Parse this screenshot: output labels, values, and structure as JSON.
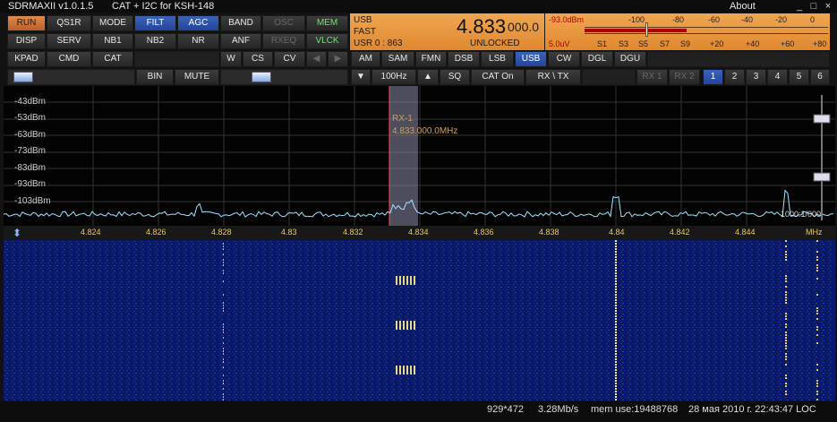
{
  "titlebar": {
    "app_name": "SDRMAXII v1.0.1.5",
    "subtitle": "CAT  + I2C for  KSH-148",
    "about": "About",
    "minimize": "_",
    "maximize": "□",
    "close": "×"
  },
  "controls": {
    "row1": [
      "RUN",
      "QS1R",
      "MODE",
      "FILT",
      "AGC",
      "BAND",
      "OSC",
      "MEM"
    ],
    "row2": [
      "DISP",
      "SERV",
      "NB1",
      "NB2",
      "NR",
      "ANF",
      "RXEQ",
      "VLCK"
    ],
    "row3": [
      "KPAD",
      "CMD",
      "CAT",
      "W",
      "CS",
      "CV"
    ],
    "modes": [
      "AM",
      "SAM",
      "FMN",
      "DSB",
      "LSB",
      "USB",
      "CW",
      "DGL",
      "DGU"
    ],
    "active_mode": "USB",
    "row4": {
      "bin": "BIN",
      "mute": "MUTE",
      "step": "100Hz",
      "sq": "SQ",
      "cat_on": "CAT On",
      "rx_tx": "RX \\ TX",
      "rx1": "RX 1",
      "rx2": "RX 2",
      "channels": [
        "1",
        "2",
        "3",
        "4",
        "5",
        "6"
      ]
    }
  },
  "status": {
    "mode": "USB",
    "agc": "FAST",
    "usr": "USR 0 : 863",
    "frequency_main": "4.833",
    "frequency_sub": "000.0",
    "lock_state": "UNLOCKED",
    "signal_dbm": "-93.0dBm",
    "signal_uv": "5.0uV",
    "dbm_scale": [
      "-100",
      "-80",
      "-60",
      "-40",
      "-20",
      "0"
    ],
    "s_scale": [
      "S1",
      "S3",
      "S5",
      "S7",
      "S9",
      "+20",
      "+40",
      "+60",
      "+80"
    ],
    "meter_level": 0.42
  },
  "spectrum": {
    "db_labels": [
      "-43dBm",
      "-53dBm",
      "-63dBm",
      "-73dBm",
      "-83dBm",
      "-93dBm",
      "-103dBm"
    ],
    "rx_label": "RX-1",
    "rx_freq": "4.833.000.0MHz",
    "freq_labels": [
      "4.824",
      "4.826",
      "4.828",
      "4.83",
      "4.832",
      "4.834",
      "4.836",
      "4.838",
      "4.84",
      "4.842",
      "4.844"
    ],
    "unit": "MHz",
    "corner_readout": "1000:1/000"
  },
  "statusbar": {
    "resolution": "929*472",
    "rate": "3.28Mb/s",
    "mem": "mem use:19488768",
    "datetime": "28 мая 2010 г. 22:43:47 LOC"
  },
  "colors": {
    "accent_orange": "#e08a4a",
    "active_blue": "#3a64b8",
    "green_text": "#6fe36f",
    "trace": "#9fe4ff",
    "passband": "#8a8aa8",
    "waterfall_bg": "#0b1a68",
    "axis_text": "#e8c860"
  }
}
